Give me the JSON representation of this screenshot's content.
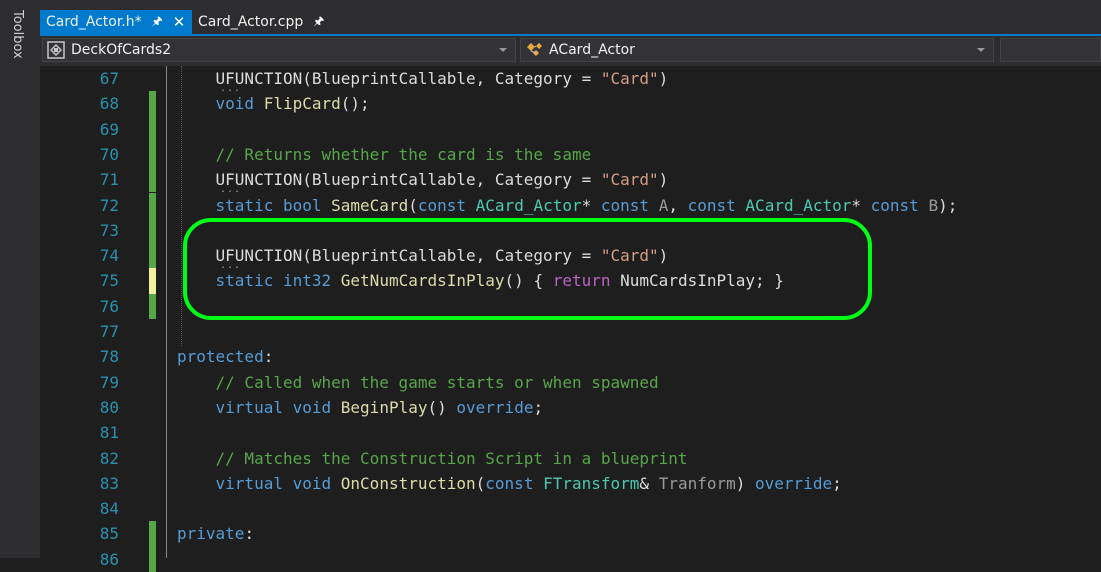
{
  "toolbox": {
    "label": "Toolbox"
  },
  "tabs": [
    {
      "label": "Card_Actor.h*",
      "active": true,
      "pinned": true,
      "closable": true,
      "close_glyph": "✕"
    },
    {
      "label": "Card_Actor.cpp",
      "active": false,
      "pinned": true,
      "closable": false
    }
  ],
  "nav": {
    "project": "DeckOfCards2",
    "scope": "ACard_Actor"
  },
  "colors": {
    "accent": "#007acc",
    "highlight_box": "#00ff16",
    "change_saved": "#57a64a",
    "change_unsaved": "#f2f29e"
  },
  "lines": [
    {
      "num": "67",
      "change": "none",
      "tokens": [
        {
          "t": "    ",
          "c": "plain"
        },
        {
          "t": "UFUNCTION",
          "c": "uf"
        },
        {
          "t": "(BlueprintCallable, Category = ",
          "c": "plain"
        },
        {
          "t": "\"Card\"",
          "c": "str"
        },
        {
          "t": ")",
          "c": "plain"
        }
      ]
    },
    {
      "num": "68",
      "change": "saved",
      "tokens": [
        {
          "t": "    ",
          "c": "plain"
        },
        {
          "t": "void",
          "c": "kw"
        },
        {
          "t": " ",
          "c": "plain"
        },
        {
          "t": "FlipCard",
          "c": "fn"
        },
        {
          "t": "();",
          "c": "plain"
        }
      ]
    },
    {
      "num": "69",
      "change": "saved",
      "tokens": []
    },
    {
      "num": "70",
      "change": "saved",
      "tokens": [
        {
          "t": "    ",
          "c": "plain"
        },
        {
          "t": "// Returns whether the card is the same",
          "c": "cmt"
        }
      ]
    },
    {
      "num": "71",
      "change": "saved",
      "tokens": [
        {
          "t": "    ",
          "c": "plain"
        },
        {
          "t": "UFUNCTION",
          "c": "uf"
        },
        {
          "t": "(BlueprintCallable, Category = ",
          "c": "plain"
        },
        {
          "t": "\"Card\"",
          "c": "str"
        },
        {
          "t": ")",
          "c": "plain"
        }
      ]
    },
    {
      "num": "72",
      "change": "saved",
      "tokens": [
        {
          "t": "    ",
          "c": "plain"
        },
        {
          "t": "static",
          "c": "kw"
        },
        {
          "t": " ",
          "c": "plain"
        },
        {
          "t": "bool",
          "c": "kw"
        },
        {
          "t": " ",
          "c": "plain"
        },
        {
          "t": "SameCard",
          "c": "fn"
        },
        {
          "t": "(",
          "c": "plain"
        },
        {
          "t": "const",
          "c": "kw"
        },
        {
          "t": " ",
          "c": "plain"
        },
        {
          "t": "ACard_Actor",
          "c": "type"
        },
        {
          "t": "* ",
          "c": "plain"
        },
        {
          "t": "const",
          "c": "kw"
        },
        {
          "t": " ",
          "c": "plain"
        },
        {
          "t": "A",
          "c": "prm"
        },
        {
          "t": ", ",
          "c": "plain"
        },
        {
          "t": "const",
          "c": "kw"
        },
        {
          "t": " ",
          "c": "plain"
        },
        {
          "t": "ACard_Actor",
          "c": "type"
        },
        {
          "t": "* ",
          "c": "plain"
        },
        {
          "t": "const",
          "c": "kw"
        },
        {
          "t": " ",
          "c": "plain"
        },
        {
          "t": "B",
          "c": "prm"
        },
        {
          "t": ");",
          "c": "plain"
        }
      ]
    },
    {
      "num": "73",
      "change": "saved",
      "tokens": []
    },
    {
      "num": "74",
      "change": "saved",
      "tokens": [
        {
          "t": "    ",
          "c": "plain"
        },
        {
          "t": "UFUNCTION",
          "c": "uf"
        },
        {
          "t": "(BlueprintCallable, Category = ",
          "c": "plain"
        },
        {
          "t": "\"Card\"",
          "c": "str"
        },
        {
          "t": ")",
          "c": "plain"
        }
      ]
    },
    {
      "num": "75",
      "change": "unsaved",
      "tokens": [
        {
          "t": "    ",
          "c": "plain"
        },
        {
          "t": "static",
          "c": "kw"
        },
        {
          "t": " ",
          "c": "plain"
        },
        {
          "t": "int32",
          "c": "kw"
        },
        {
          "t": " ",
          "c": "plain"
        },
        {
          "t": "GetNumCardsInPlay",
          "c": "fn"
        },
        {
          "t": "() { ",
          "c": "plain"
        },
        {
          "t": "return",
          "c": "macro"
        },
        {
          "t": " NumCardsInPlay; }",
          "c": "plain"
        }
      ]
    },
    {
      "num": "76",
      "change": "saved",
      "tokens": []
    },
    {
      "num": "77",
      "change": "none",
      "tokens": []
    },
    {
      "num": "78",
      "change": "none",
      "tokens": [
        {
          "t": "protected",
          "c": "kw"
        },
        {
          "t": ":",
          "c": "plain"
        }
      ]
    },
    {
      "num": "79",
      "change": "none",
      "tokens": [
        {
          "t": "    ",
          "c": "plain"
        },
        {
          "t": "// Called when the game starts or when spawned",
          "c": "cmt"
        }
      ]
    },
    {
      "num": "80",
      "change": "none",
      "tokens": [
        {
          "t": "    ",
          "c": "plain"
        },
        {
          "t": "virtual",
          "c": "kw"
        },
        {
          "t": " ",
          "c": "plain"
        },
        {
          "t": "void",
          "c": "kw"
        },
        {
          "t": " ",
          "c": "plain"
        },
        {
          "t": "BeginPlay",
          "c": "fn"
        },
        {
          "t": "() ",
          "c": "plain"
        },
        {
          "t": "override",
          "c": "kw"
        },
        {
          "t": ";",
          "c": "plain"
        }
      ]
    },
    {
      "num": "81",
      "change": "none",
      "tokens": []
    },
    {
      "num": "82",
      "change": "none",
      "tokens": [
        {
          "t": "    ",
          "c": "plain"
        },
        {
          "t": "// Matches the Construction Script in a blueprint",
          "c": "cmt"
        }
      ]
    },
    {
      "num": "83",
      "change": "none",
      "tokens": [
        {
          "t": "    ",
          "c": "plain"
        },
        {
          "t": "virtual",
          "c": "kw"
        },
        {
          "t": " ",
          "c": "plain"
        },
        {
          "t": "void",
          "c": "kw"
        },
        {
          "t": " ",
          "c": "plain"
        },
        {
          "t": "OnConstruction",
          "c": "fn"
        },
        {
          "t": "(",
          "c": "plain"
        },
        {
          "t": "const",
          "c": "kw"
        },
        {
          "t": " ",
          "c": "plain"
        },
        {
          "t": "FTransform",
          "c": "type"
        },
        {
          "t": "& ",
          "c": "plain"
        },
        {
          "t": "Tranform",
          "c": "prm"
        },
        {
          "t": ") ",
          "c": "plain"
        },
        {
          "t": "override",
          "c": "kw"
        },
        {
          "t": ";",
          "c": "plain"
        }
      ]
    },
    {
      "num": "84",
      "change": "none",
      "tokens": []
    },
    {
      "num": "85",
      "change": "saved",
      "tokens": [
        {
          "t": "private",
          "c": "kw"
        },
        {
          "t": ":",
          "c": "plain"
        }
      ]
    },
    {
      "num": "86",
      "change": "saved",
      "tokens": []
    }
  ]
}
